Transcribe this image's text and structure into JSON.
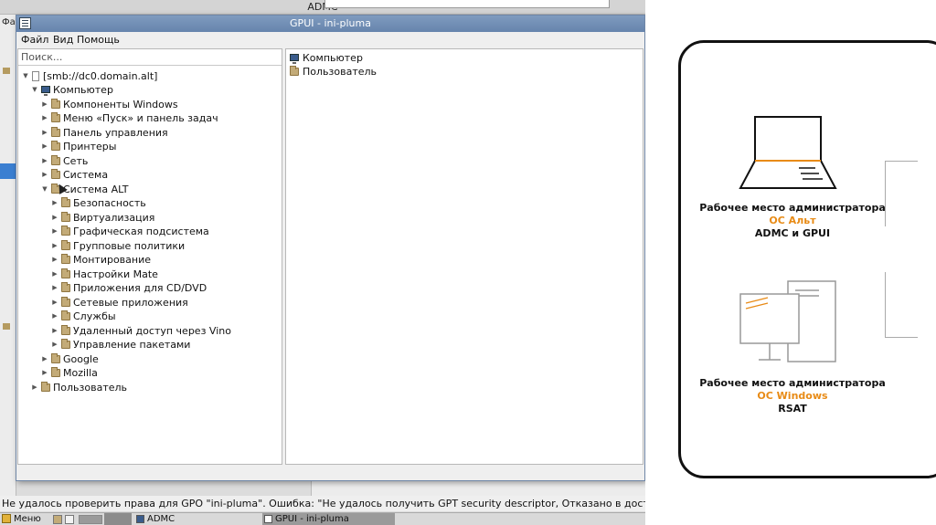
{
  "admc": {
    "title": "ADMC",
    "menu_stub": "Фа"
  },
  "gpui": {
    "title": "GPUI - ini-pluma",
    "menu": [
      "Файл",
      "Вид",
      "Помощь"
    ],
    "search_placeholder": "Поиск...",
    "tree": {
      "root": "[smb://dc0.domain.alt]",
      "computer": "Компьютер",
      "computer_children": [
        "Компоненты Windows",
        "Меню «Пуск» и панель задач",
        "Панель управления",
        "Принтеры",
        "Сеть",
        "Система"
      ],
      "alt_system": "Система ALT",
      "alt_children": [
        "Безопасность",
        "Виртуализация",
        "Графическая подсистема",
        "Групповые политики",
        "Монтирование",
        "Настройки Mate",
        "Приложения для CD/DVD",
        "Сетевые приложения",
        "Службы",
        "Удаленный доступ через Vino",
        "Управление пакетами"
      ],
      "after_alt": [
        "Google",
        "Mozilla"
      ],
      "user": "Пользователь"
    },
    "right_items": [
      "Компьютер",
      "Пользователь"
    ]
  },
  "status_message": "Не удалось проверить права для GPO \"ini-pluma\". Ошибка: \"Не удалось получить GPT security descriptor, Отказано в доступе.\".",
  "taskbar": {
    "menu_label": "Меню",
    "tasks": [
      "ADMC",
      "GPUI - ini-pluma"
    ]
  },
  "diagram": {
    "ws1": {
      "line1": "Рабочее место администратора",
      "line2": "ОС Альт",
      "line3": "ADMC и GPUI"
    },
    "ws2": {
      "line1": "Рабочее место администратора",
      "line2": "ОС Windows",
      "line3": "RSAT"
    },
    "accent_color": "#e88b16"
  }
}
